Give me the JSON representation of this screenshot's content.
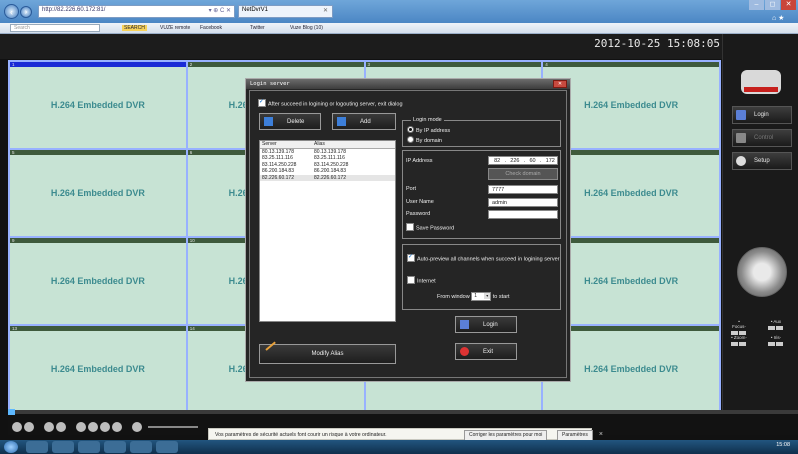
{
  "browser": {
    "address": "http://82.226.60.172:81/",
    "address_controls": "▾ ⊕ C ✕",
    "tab_title": "NetDvrV1",
    "window_controls": [
      "–",
      "◻",
      "✕"
    ],
    "favorites": {
      "search_placeholder": "Search",
      "items": [
        "SEARCH",
        "VUZE remote",
        "Facebook",
        "Twitter",
        "Vuze Blog (10)"
      ]
    }
  },
  "dvr": {
    "datetime": "2012-10-25 15:08:05",
    "channels": [
      {
        "num": "1",
        "label": "H.264 Embedded DVR"
      },
      {
        "num": "2",
        "label": "H.264 Embedded DVR"
      },
      {
        "num": "3",
        "label": ""
      },
      {
        "num": "4",
        "label": "H.264 Embedded DVR"
      },
      {
        "num": "5",
        "label": "H.264 Embedded DVR"
      },
      {
        "num": "6",
        "label": "H.264 Embedded DVR"
      },
      {
        "num": "",
        "label": ""
      },
      {
        "num": "",
        "label": "H.264 Embedded DVR"
      },
      {
        "num": "9",
        "label": "H.264 Embedded DVR"
      },
      {
        "num": "10",
        "label": "H.264 Embedded DVR"
      },
      {
        "num": "",
        "label": ""
      },
      {
        "num": "",
        "label": "H.264 Embedded DVR"
      },
      {
        "num": "13",
        "label": "H.264 Embedded DVR"
      },
      {
        "num": "14",
        "label": "H.264 Embedded DVR"
      },
      {
        "num": "",
        "label": ""
      },
      {
        "num": "",
        "label": "H.264 Embedded DVR"
      }
    ],
    "side_buttons": {
      "login": "Login",
      "control": "Control",
      "setup": "Setup"
    },
    "ptz": {
      "focus": "• Focus-",
      "aux": "• Aux",
      "zoom": "• Zoom-",
      "iris": "• Iris-"
    }
  },
  "dialog": {
    "title": "Login server",
    "close": "✕",
    "exit_dialog_label": "After succeed in logining or logouting server, exit dialog",
    "delete_label": "Delete",
    "add_label": "Add",
    "list_headers": [
      "Server",
      "Alias"
    ],
    "servers": [
      {
        "server": "80.13.139.178",
        "alias": "80.13.139.178"
      },
      {
        "server": "83.25.111.116",
        "alias": "83.25.111.116"
      },
      {
        "server": "83.114.250.228",
        "alias": "83.114.250.228"
      },
      {
        "server": "86.200.184.83",
        "alias": "86.200.184.83"
      },
      {
        "server": "82.226.60.172",
        "alias": "82.226.60.172"
      }
    ],
    "modify_alias_label": "Modify Alias",
    "login_mode_title": "Login mode",
    "mode_ip": "By IP address",
    "mode_domain": "By domain",
    "ip_label": "IP Address",
    "ip_octets": [
      "82",
      "226",
      "60",
      "172"
    ],
    "ip_dots": [
      ".",
      ".",
      "."
    ],
    "check_domain_label": "Check domain",
    "port_label": "Port",
    "port_value": "7777",
    "user_label": "User Name",
    "user_value": "admin",
    "password_label": "Password",
    "password_value": "",
    "save_password_label": "Save Password",
    "auto_preview_label": "Auto-preview all channels when succeed in logining server",
    "internet_label": "Internet",
    "from_window_label": "From window",
    "from_window_value": "1",
    "to_start_label": "to start",
    "login_button": "Login",
    "exit_button": "Exit"
  },
  "notification": {
    "text": "Vos paramètres de sécurité actuels font courir un risque à votre ordinateur.",
    "fix_button": "Corriger les paramètres pour moi",
    "settings_button": "Paramètres",
    "close": "×"
  },
  "taskbar": {
    "time": "15:08",
    "date": "25/10/2012"
  }
}
